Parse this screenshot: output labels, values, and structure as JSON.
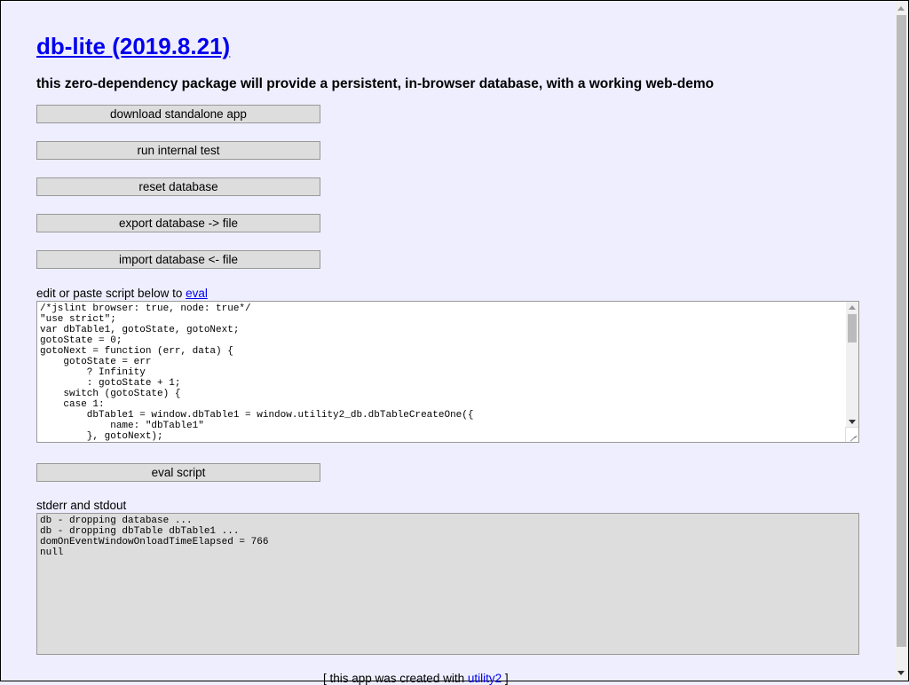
{
  "header": {
    "title": "db-lite (2019.8.21)",
    "subtitle": "this zero-dependency package will provide a persistent, in-browser database, with a working web-demo"
  },
  "buttons": {
    "download": "download standalone app",
    "run_test": "run internal test",
    "reset": "reset database",
    "export": "export database -> file",
    "import": "import database <- file",
    "eval": "eval script"
  },
  "editor": {
    "label_prefix": "edit or paste script below to ",
    "label_link": "eval",
    "script": "/*jslint browser: true, node: true*/\n\"use strict\";\nvar dbTable1, gotoState, gotoNext;\ngotoState = 0;\ngotoNext = function (err, data) {\n    gotoState = err\n        ? Infinity\n        : gotoState + 1;\n    switch (gotoState) {\n    case 1:\n        dbTable1 = window.dbTable1 = window.utility2_db.dbTableCreateOne({\n            name: \"dbTable1\"\n        }, gotoNext);\n        break;"
  },
  "output": {
    "label": "stderr and stdout",
    "text": "db - dropping database ...\ndb - dropping dbTable dbTable1 ...\ndomOnEventWindowOnloadTimeElapsed = 766\nnull"
  },
  "footer": {
    "prefix": "[ this app was created with ",
    "link": "utility2",
    "suffix": " ]"
  }
}
